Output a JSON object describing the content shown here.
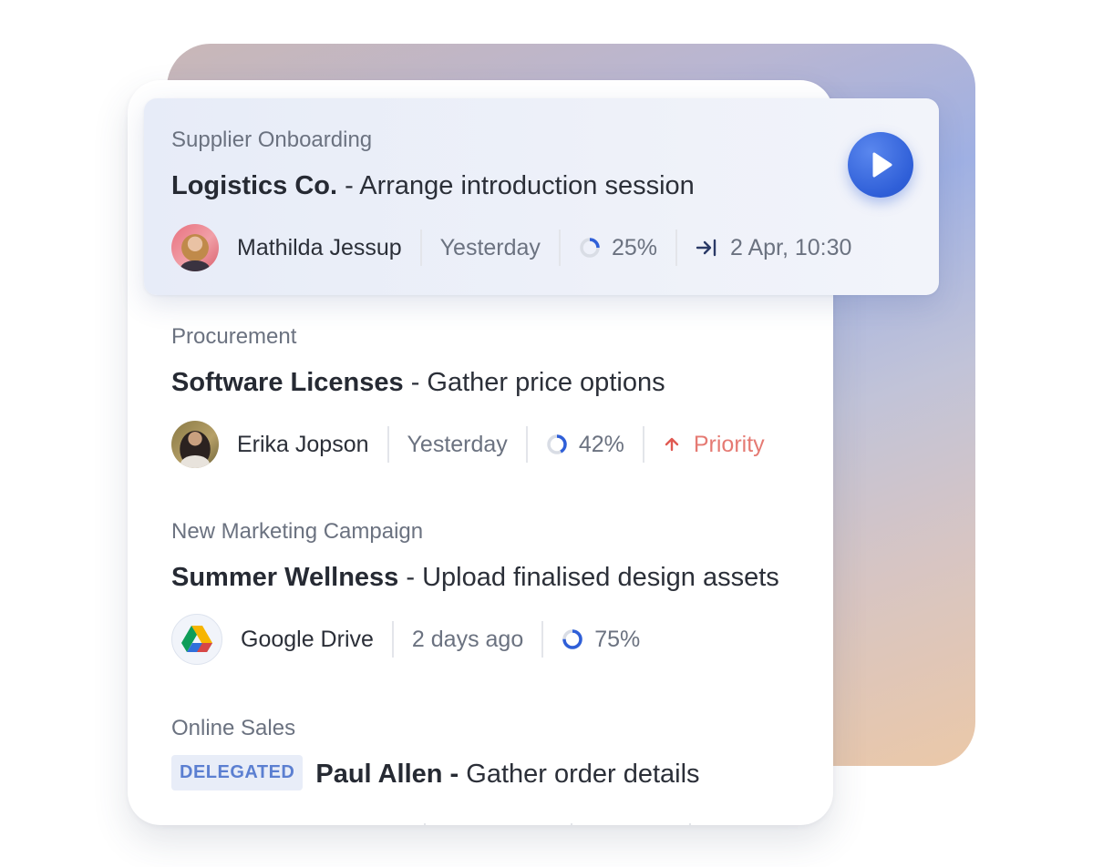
{
  "tasks": [
    {
      "category": "Supplier Onboarding",
      "title_bold": "Logistics Co.",
      "title_rest": " - Arrange introduction session",
      "assignee": "Mathilda Jessup",
      "updated": "Yesterday",
      "progress": 25,
      "progress_label": "25%",
      "due": "2 Apr, 10:30"
    },
    {
      "category": "Procurement",
      "title_bold": "Software Licenses",
      "title_rest": " - Gather price options",
      "assignee": "Erika Jopson",
      "updated": "Yesterday",
      "progress": 42,
      "progress_label": "42%",
      "priority": "Priority"
    },
    {
      "category": "New Marketing Campaign",
      "title_bold": "Summer Wellness",
      "title_rest": " - Upload finalised design assets",
      "assignee": "Google Drive",
      "updated": "2 days ago",
      "progress": 75,
      "progress_label": "75%"
    },
    {
      "category": "Online Sales",
      "badge": "DELEGATED",
      "title_bold": "Paul Allen -",
      "title_rest": " Gather order details"
    }
  ],
  "colors": {
    "accent": "#2f5fd8",
    "priority": "#e57a73",
    "badge_bg": "#e8edf8"
  },
  "icons": {
    "play": "play-icon",
    "due": "arrow-to-line-icon",
    "priority": "arrow-up-icon",
    "progress": "progress-ring-icon",
    "drive": "google-drive-icon"
  }
}
